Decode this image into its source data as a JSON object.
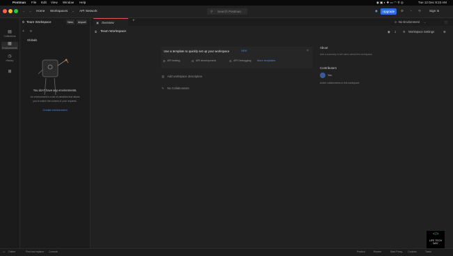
{
  "menubar": {
    "app": "Postman",
    "items": [
      "File",
      "Edit",
      "View",
      "Window",
      "Help"
    ],
    "clock": "Tue 12 Dec 8:23 AM"
  },
  "toolbar": {
    "home": "Home",
    "workspaces": "Workspaces",
    "api_network": "API Network",
    "search_placeholder": "Search Postman",
    "upgrade": "Upgrade",
    "sign_in": "Sign In"
  },
  "rail": {
    "items": [
      {
        "label": "Collections",
        "icon": "collections-icon"
      },
      {
        "label": "Environments",
        "icon": "environments-icon"
      },
      {
        "label": "History",
        "icon": "history-icon"
      },
      {
        "label": "",
        "icon": "apps-icon"
      }
    ]
  },
  "sidebar": {
    "workspace_name": "Team Workspace",
    "new_label": "New",
    "import_label": "Import",
    "section": "Globals",
    "empty_title": "You don't have any environments.",
    "empty_line1": "An environment is a set of variables that allows",
    "empty_line2": "you to switch the context of your requests.",
    "create_link": "Create environment"
  },
  "tabs": {
    "overview": "Overview",
    "env_select": "No Environment"
  },
  "workspace": {
    "title": "Team Workspace",
    "watch_count": "1",
    "settings": "Workspace Settings",
    "template_prompt": "Use a template to quickly set up your workspace",
    "new_badge": "NEW",
    "templates": [
      "API testing",
      "API development",
      "API Debugging",
      "More templates"
    ],
    "summary_placeholder": "Add workspace description",
    "collaborators": "No Collaborators",
    "about_title": "About",
    "about_text": "Add a summary to tell users about this workspace.",
    "contributors_title": "Contributors",
    "contributor": "You",
    "activity_text": "Active collaborators in this workspace"
  },
  "status": {
    "left": [
      "Online",
      "Find and replace",
      "Console"
    ],
    "right": [
      "Postbot",
      "Runner",
      "Start Proxy",
      "Cookies",
      "Trash"
    ]
  },
  "watermark": "LIFE TECH WAY"
}
